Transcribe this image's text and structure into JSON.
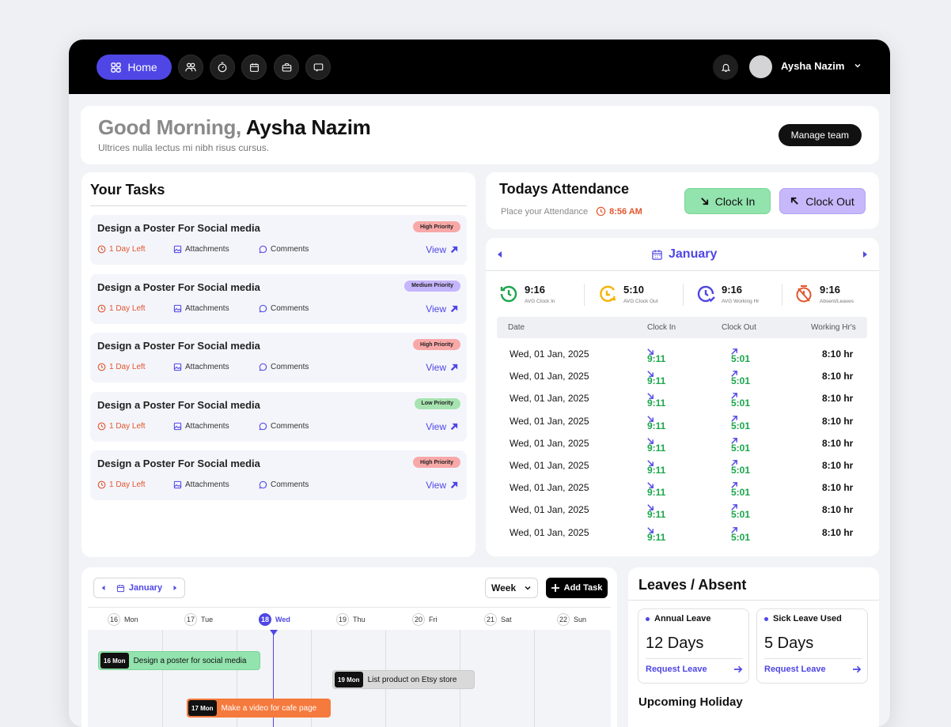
{
  "nav": {
    "home_label": "Home",
    "icons": [
      "users-icon",
      "timer-icon",
      "calendar-icon",
      "briefcase-icon",
      "chat-icon"
    ]
  },
  "user": {
    "name": "Aysha Nazim"
  },
  "greeting": {
    "prefix": "Good Morning,",
    "name": "Aysha Nazim",
    "subtitle": "Ultrices nulla lectus mi nibh risus cursus.",
    "manage_label": "Manage team"
  },
  "tasks": {
    "title": "Your Tasks",
    "items": [
      {
        "title": "Design a Poster For Social media",
        "priority": "High Priority",
        "time_left": "1 Day Left",
        "attachments": "Attachments",
        "comments": "Comments",
        "view": "View"
      },
      {
        "title": "Design a Poster For Social media",
        "priority": "Medium Priority",
        "time_left": "1 Day Left",
        "attachments": "Attachments",
        "comments": "Comments",
        "view": "View"
      },
      {
        "title": "Design a Poster For Social media",
        "priority": "High Priority",
        "time_left": "1 Day Left",
        "attachments": "Attachments",
        "comments": "Comments",
        "view": "View"
      },
      {
        "title": "Design a Poster For Social media",
        "priority": "Low Priority",
        "time_left": "1 Day Left",
        "attachments": "Attachments",
        "comments": "Comments",
        "view": "View"
      },
      {
        "title": "Design a Poster For Social media",
        "priority": "High Priority",
        "time_left": "1 Day Left",
        "attachments": "Attachments",
        "comments": "Comments",
        "view": "View"
      }
    ]
  },
  "priority_colors": {
    "High Priority": "#f9a8a8",
    "Medium Priority": "#c4b5fd",
    "Low Priority": "#a7e3b0"
  },
  "attendance": {
    "title": "Todays Attendance",
    "subtitle": "Place your Attendance",
    "time": "8:56 AM",
    "clock_in_label": "Clock In",
    "clock_out_label": "Clock Out"
  },
  "calendar": {
    "month": "January",
    "stats": [
      {
        "value": "9:16",
        "label": "AVG Clock In",
        "color": "#1aa64a"
      },
      {
        "value": "5:10",
        "label": "AVG Clock Out",
        "color": "#f5b301"
      },
      {
        "value": "9:16",
        "label": "AVG Working Hr",
        "color": "#4f46e5"
      },
      {
        "value": "9:16",
        "label": "Absent/Leaves",
        "color": "#e2562e"
      }
    ],
    "columns": [
      "Date",
      "Clock In",
      "Clock Out",
      "Working Hr's"
    ],
    "rows": [
      {
        "date": "Wed, 01 Jan, 2025",
        "in": "9:11",
        "out": "5:01",
        "hours": "8:10 hr"
      },
      {
        "date": "Wed, 01 Jan, 2025",
        "in": "9:11",
        "out": "5:01",
        "hours": "8:10 hr"
      },
      {
        "date": "Wed, 01 Jan, 2025",
        "in": "9:11",
        "out": "5:01",
        "hours": "8:10 hr"
      },
      {
        "date": "Wed, 01 Jan, 2025",
        "in": "9:11",
        "out": "5:01",
        "hours": "8:10 hr"
      },
      {
        "date": "Wed, 01 Jan, 2025",
        "in": "9:11",
        "out": "5:01",
        "hours": "8:10 hr"
      },
      {
        "date": "Wed, 01 Jan, 2025",
        "in": "9:11",
        "out": "5:01",
        "hours": "8:10 hr"
      },
      {
        "date": "Wed, 01 Jan, 2025",
        "in": "9:11",
        "out": "5:01",
        "hours": "8:10 hr"
      },
      {
        "date": "Wed, 01 Jan, 2025",
        "in": "9:11",
        "out": "5:01",
        "hours": "8:10 hr"
      },
      {
        "date": "Wed, 01 Jan, 2025",
        "in": "9:11",
        "out": "5:01",
        "hours": "8:10 hr"
      }
    ]
  },
  "schedule": {
    "month": "January",
    "view": "Week",
    "add_label": "Add Task",
    "days": [
      {
        "num": "16",
        "name": "Mon",
        "active": false
      },
      {
        "num": "17",
        "name": "Tue",
        "active": false
      },
      {
        "num": "18",
        "name": "Wed",
        "active": true
      },
      {
        "num": "19",
        "name": "Thu",
        "active": false
      },
      {
        "num": "20",
        "name": "Fri",
        "active": false
      },
      {
        "num": "21",
        "name": "Sat",
        "active": false
      },
      {
        "num": "22",
        "name": "Sun",
        "active": false
      }
    ],
    "events": [
      {
        "date": "16 Mon",
        "title": "Design a poster for social media",
        "color": "#92e3ad"
      },
      {
        "date": "19 Mon",
        "title": "List product on Etsy store",
        "color": "#d9d9d9"
      },
      {
        "date": "17 Mon",
        "title": "Make a video for cafe page",
        "color": "#f57a3d"
      }
    ]
  },
  "leaves": {
    "title": "Leaves / Absent",
    "cards": [
      {
        "title": "Annual Leave",
        "value": "12 Days",
        "action": "Request Leave"
      },
      {
        "title": "Sick Leave Used",
        "value": "5 Days",
        "action": "Request Leave"
      }
    ],
    "upcoming_title": "Upcoming Holiday"
  }
}
